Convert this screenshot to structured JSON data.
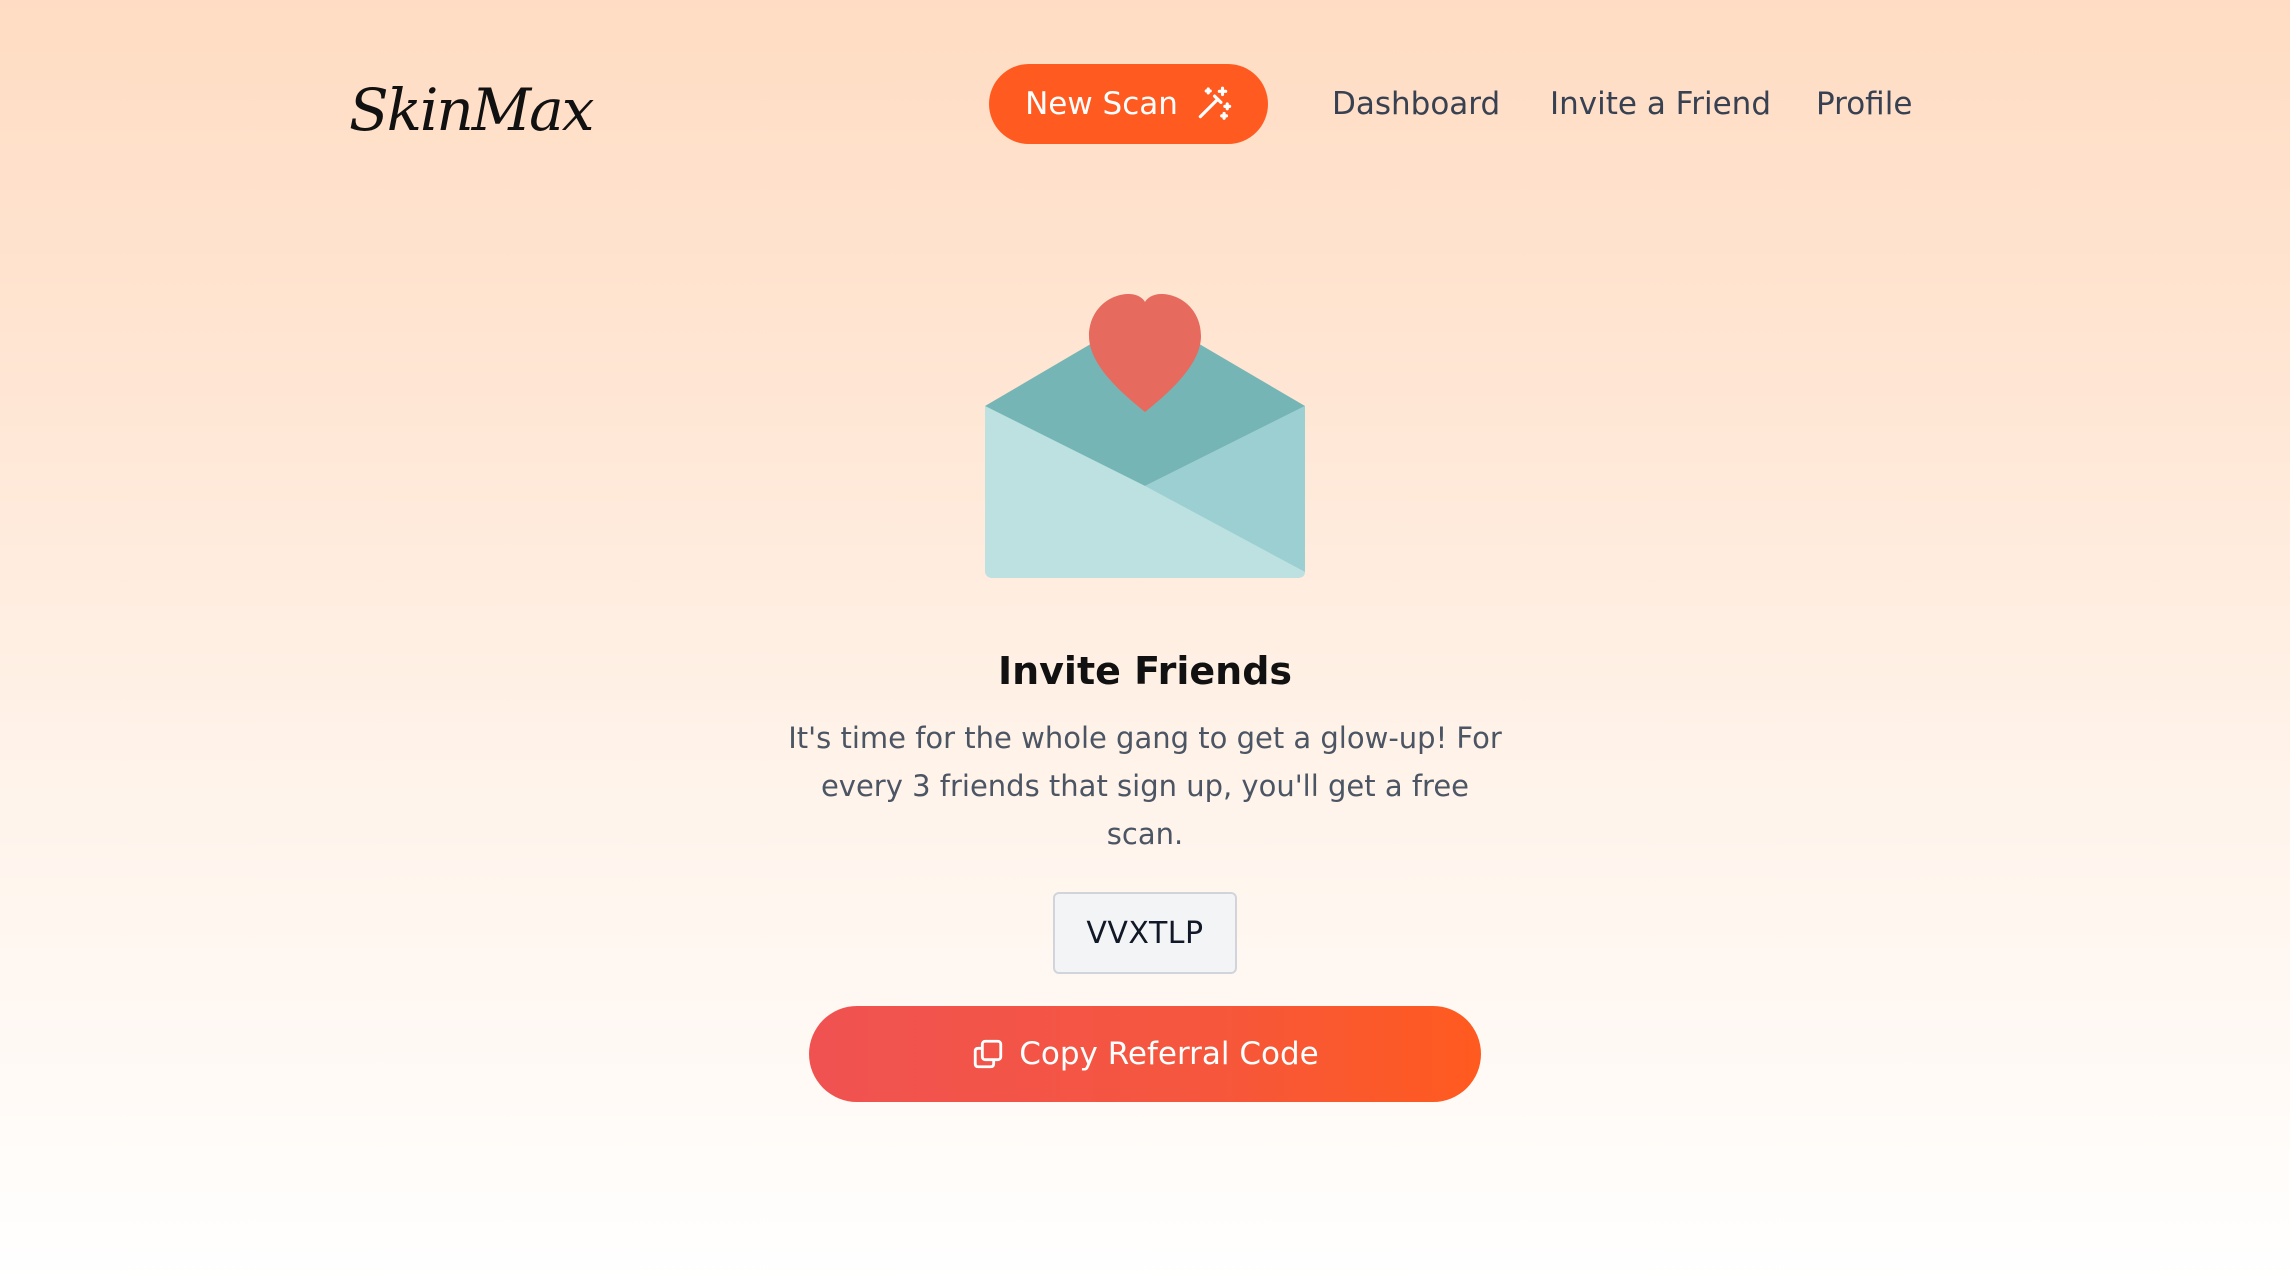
{
  "header": {
    "logo": "SkinMax",
    "new_scan_label": "New Scan",
    "new_scan_icon": "magic-wand-icon",
    "nav": {
      "dashboard": "Dashboard",
      "invite": "Invite a Friend",
      "profile": "Profile"
    }
  },
  "main": {
    "illustration": "envelope-heart-icon",
    "title": "Invite Friends",
    "description": "It's time for the whole gang to get a glow-up! For every 3 friends that sign up, you'll get a free scan.",
    "referral_code": "VVXTLP",
    "copy_button_label": "Copy Referral Code",
    "copy_icon": "copy-icon"
  },
  "colors": {
    "accent": "#ff5a1f",
    "button_gradient_start": "#f05252",
    "button_gradient_end": "#ff5a1f",
    "heart": "#e76a5e",
    "envelope_dark": "#76b5b5",
    "envelope_mid": "#9ccfd2",
    "envelope_light": "#bde0e1"
  }
}
